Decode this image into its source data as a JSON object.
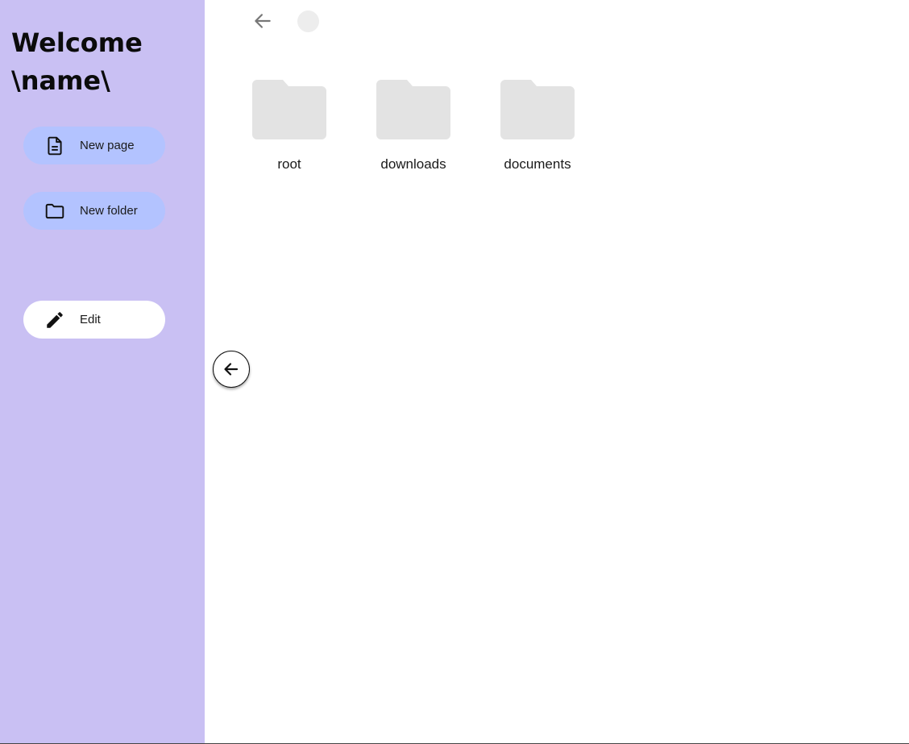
{
  "sidebar": {
    "welcome_line1": "Welcome",
    "welcome_line2": "\\name\\",
    "background": "#c9c0f3",
    "buttons": [
      {
        "label": "New page",
        "icon": "document-icon",
        "color": "#b3c3ff"
      },
      {
        "label": "New folder",
        "icon": "folder-icon",
        "color": "#b3c3ff"
      },
      {
        "label": "Edit",
        "icon": "pencil-icon",
        "color": "#ffffff"
      }
    ]
  },
  "toolbar": {
    "back_icon": "arrow-left-icon",
    "status_indicator_color": "#ededed"
  },
  "folders": [
    {
      "name": "root",
      "icon": "folder-icon",
      "color": "#e3e3e3"
    },
    {
      "name": "downloads",
      "icon": "folder-icon",
      "color": "#e3e3e3"
    },
    {
      "name": "documents",
      "icon": "folder-icon",
      "color": "#e3e3e3"
    }
  ],
  "collapse_button": {
    "icon": "arrow-left-circle-icon"
  }
}
